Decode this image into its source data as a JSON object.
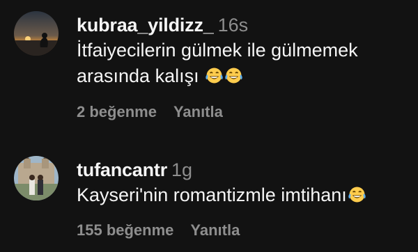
{
  "comments": [
    {
      "username": "kubraa_yildizz_",
      "time": "16s",
      "text": "İtfaiyecilerin gülmek ile gülmemek arasında kalışı",
      "emoji": [
        "face-with-tears-of-joy-icon",
        "face-with-tears-of-joy-icon"
      ],
      "likes": "2 beğenme",
      "reply": "Yanıtla"
    },
    {
      "username": "tufancantr",
      "time": "1g",
      "text": "Kayseri'nin romantizmle imtihanı",
      "emoji": [
        "face-with-tears-of-joy-icon"
      ],
      "likes": "155 beğenme",
      "reply": "Yanıtla"
    }
  ],
  "colors": {
    "background": "#121212",
    "primary_text": "#f5f5f5",
    "secondary_text": "#8e8e8e"
  }
}
